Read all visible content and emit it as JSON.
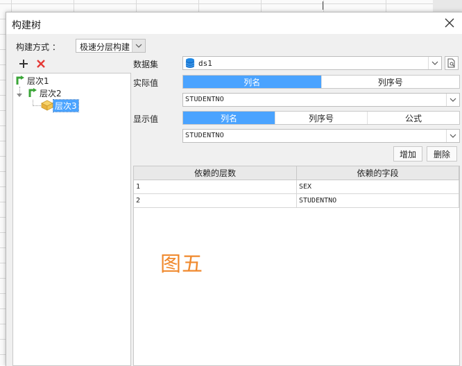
{
  "dialog": {
    "title": "构建树",
    "close_icon": "close-icon"
  },
  "build_mode": {
    "label": "构建方式 ：",
    "value": "极速分层构建"
  },
  "tree": {
    "add_icon": "plus-icon",
    "delete_icon": "red-x-icon",
    "nodes": [
      {
        "label": "层次1",
        "level": 0,
        "expanded": false,
        "selected": false,
        "icon": "green-arrow-icon"
      },
      {
        "label": "层次2",
        "level": 1,
        "expanded": true,
        "selected": false,
        "icon": "green-arrow-icon"
      },
      {
        "label": "层次3",
        "level": 2,
        "expanded": false,
        "selected": true,
        "icon": "yellow-box-icon"
      }
    ]
  },
  "dataset": {
    "label": "数据集",
    "value": "ds1",
    "icon": "database-icon"
  },
  "actual_value": {
    "label": "实际值",
    "options": [
      "列名",
      "列序号"
    ],
    "active": "列名",
    "field": "STUDENTNO"
  },
  "display_value": {
    "label": "显示值",
    "options": [
      "列名",
      "列序号",
      "公式"
    ],
    "active": "列名",
    "field": "STUDENTNO"
  },
  "buttons": {
    "add": "增加",
    "delete": "删除"
  },
  "table": {
    "headers": [
      "依赖的层数",
      "依赖的字段"
    ],
    "rows": [
      [
        "1",
        "SEX"
      ],
      [
        "2",
        "STUDENTNO"
      ]
    ]
  },
  "watermark": "图五",
  "colors": {
    "accent": "#4aa3ff",
    "watermark": "#f0892d",
    "delete": "#e53935",
    "tree_green": "#3aa537"
  }
}
